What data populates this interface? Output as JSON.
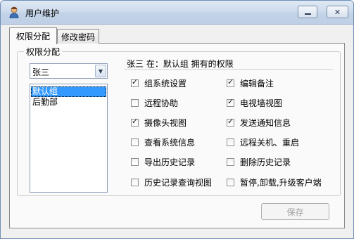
{
  "window": {
    "title": "用户维护",
    "icon": "user-icon"
  },
  "tabs": [
    {
      "label": "权限分配",
      "active": true
    },
    {
      "label": "修改密码",
      "active": false
    }
  ],
  "group": {
    "legend": "权限分配"
  },
  "user_select": {
    "value": "张三"
  },
  "group_list": {
    "items": [
      "默认组",
      "后勤部"
    ],
    "selected": 0
  },
  "permissions": {
    "title": "张三 在：默认组 拥有的权限",
    "items": [
      {
        "label": "组系统设置",
        "checked": true
      },
      {
        "label": "编辑备注",
        "checked": true
      },
      {
        "label": "远程协助",
        "checked": false
      },
      {
        "label": "电视墙视图",
        "checked": true
      },
      {
        "label": "摄像头视图",
        "checked": true
      },
      {
        "label": "发送通知信息",
        "checked": true
      },
      {
        "label": "查看系统信息",
        "checked": false
      },
      {
        "label": "远程关机、重启",
        "checked": false
      },
      {
        "label": "导出历史记录",
        "checked": false
      },
      {
        "label": "删除历史记录",
        "checked": false
      },
      {
        "label": "历史记录查询视图",
        "checked": false
      },
      {
        "label": "暂停,卸载,升级客户端",
        "checked": false
      }
    ]
  },
  "buttons": {
    "save": "保存"
  }
}
